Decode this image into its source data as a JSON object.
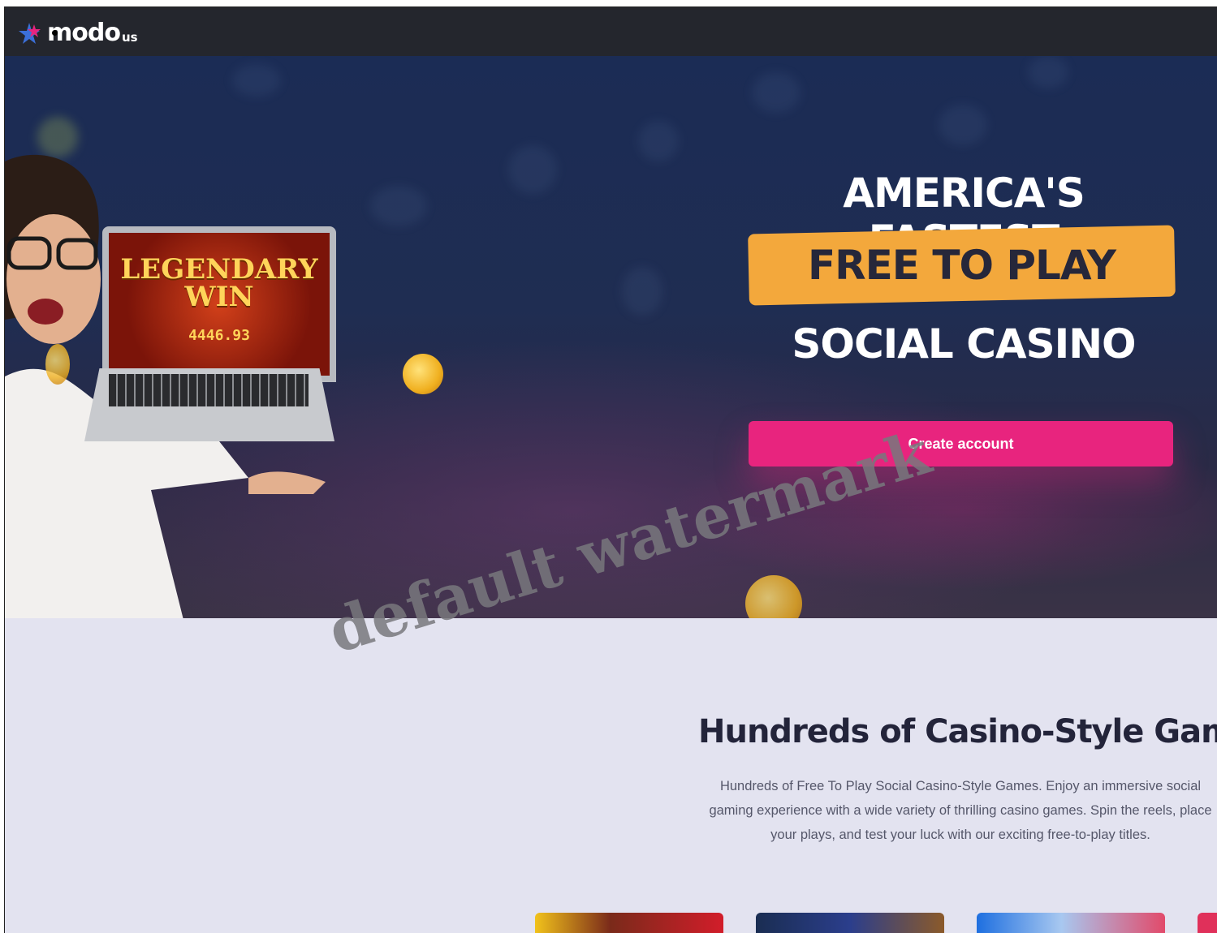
{
  "brand": {
    "name": "modo",
    "suffix": "us"
  },
  "hero": {
    "line1": "AMERICA'S FASTEST",
    "badge": "FREE TO PLAY",
    "line3": "SOCIAL CASINO",
    "cta_label": "Create account",
    "laptop_text": "LEGENDARY WIN",
    "laptop_amount": "4446.93"
  },
  "games_section": {
    "title": "Hundreds of Casino-Style Games",
    "description": "Hundreds of Free To Play Social Casino-Style Games. Enjoy an immersive social gaming experience with a wide variety of thrilling casino games. Spin the reels, place your plays, and test your luck with our exciting free-to-play titles."
  },
  "watermark": "default watermark",
  "colors": {
    "topbar": "#24262d",
    "accent_pink": "#e8247e",
    "badge_orange": "#f3a83c",
    "section_bg": "#e3e3f0"
  }
}
